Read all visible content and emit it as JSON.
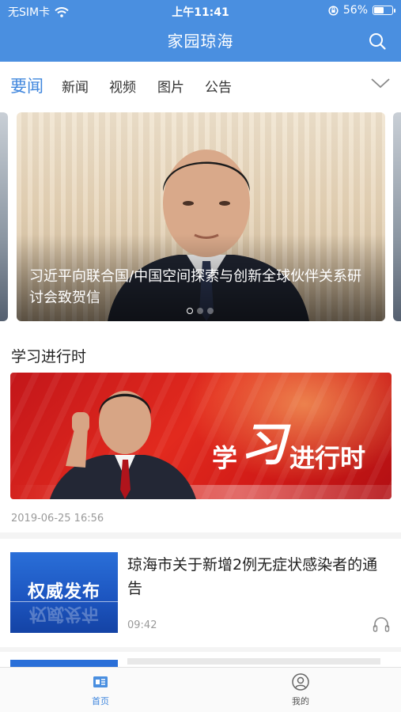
{
  "status_bar": {
    "carrier": "无SIM卡",
    "time": "上午11:41",
    "battery_percent": "56%",
    "battery_level": 0.56,
    "icons": [
      "wifi-icon",
      "orientation-lock-icon",
      "battery-icon"
    ]
  },
  "header": {
    "title": "家园琼海",
    "search_icon": "search-icon",
    "background_color": "#4a8fe0"
  },
  "tabs": {
    "items": [
      {
        "label": "要闻",
        "active": true
      },
      {
        "label": "新闻",
        "active": false
      },
      {
        "label": "视频",
        "active": false
      },
      {
        "label": "图片",
        "active": false
      },
      {
        "label": "公告",
        "active": false
      }
    ],
    "more_icon": "chevron-down-icon",
    "active_color": "#3f86dd"
  },
  "carousel": {
    "caption": "习近平向联合国/中国空间探索与创新全球伙伴关系研讨会致贺信",
    "slide_count": 3,
    "active_index": 0
  },
  "section": {
    "title": "学习进行时",
    "banner": {
      "char1": "学",
      "char2": "习",
      "rest": "进行时"
    },
    "date": "2019-06-25 16:56"
  },
  "news": [
    {
      "thumb_text": "权威发布",
      "title": "琼海市关于新增2例无症状感染者的通告",
      "time": "09:42",
      "audio_icon": "headphone-icon"
    }
  ],
  "bottom_nav": {
    "items": [
      {
        "label": "首页",
        "icon": "home-icon",
        "active": true
      },
      {
        "label": "我的",
        "icon": "user-icon",
        "active": false
      }
    ]
  }
}
